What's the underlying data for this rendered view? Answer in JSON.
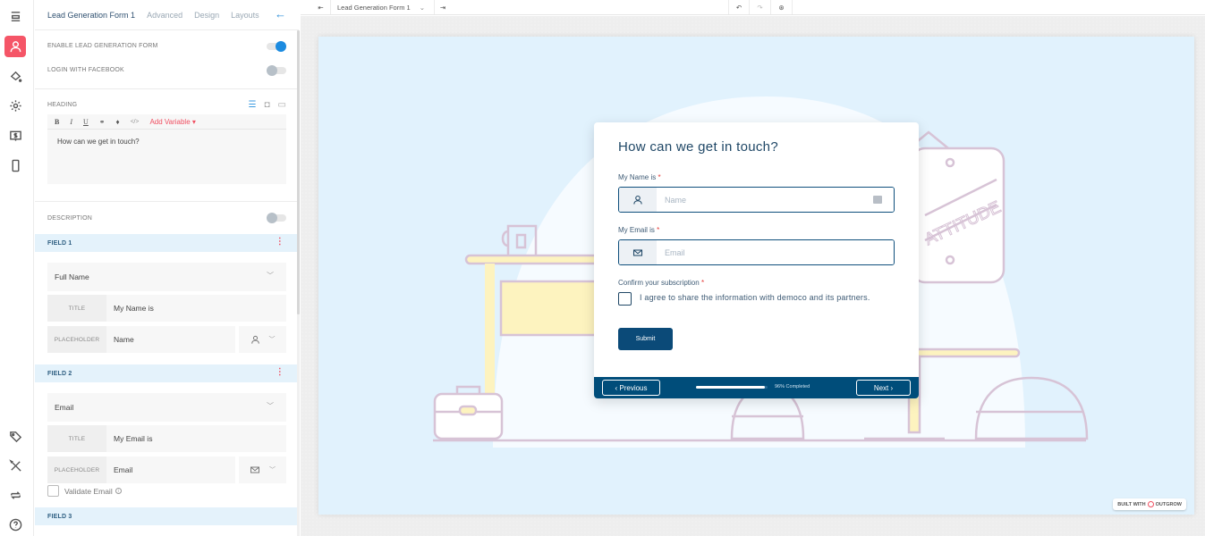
{
  "rail": {
    "items": [
      {
        "icon": "menu-icon",
        "active": false
      },
      {
        "icon": "user-icon",
        "active": true
      },
      {
        "icon": "paint-bucket-icon",
        "active": false
      },
      {
        "icon": "gear-icon",
        "active": false
      },
      {
        "icon": "pricing-icon",
        "active": false
      },
      {
        "icon": "mobile-icon",
        "active": false
      },
      {
        "icon": "tag-icon",
        "active": false
      },
      {
        "icon": "tools-icon",
        "active": false
      },
      {
        "icon": "sync-icon",
        "active": false
      },
      {
        "icon": "help-icon",
        "active": false
      }
    ]
  },
  "panel": {
    "tabs": [
      "Lead Generation Form 1",
      "Advanced",
      "Design",
      "Layouts"
    ],
    "active_tab": "Lead Generation Form 1",
    "back_icon": "←",
    "toggles": [
      {
        "label": "ENABLE LEAD GENERATION FORM",
        "on": true
      },
      {
        "label": "LOGIN WITH FACEBOOK",
        "on": false
      }
    ],
    "heading": {
      "label": "HEADING",
      "tools": [
        "☰",
        "◘",
        "▭"
      ],
      "toolbar": [
        "B",
        "I",
        "U",
        "⚭",
        "♦",
        "</>"
      ],
      "add_variable": "Add Variable ▾",
      "text": "How can we get in touch?"
    },
    "description": {
      "label": "DESCRIPTION",
      "on": false
    },
    "fields": [
      {
        "header": "FIELD 1",
        "type": "Full Name",
        "title_label": "TITLE",
        "title": "My Name is",
        "placeholder_label": "PLACEHOLDER",
        "placeholder": "Name",
        "icon": "user-icon"
      },
      {
        "header": "FIELD 2",
        "type": "Email",
        "title_label": "TITLE",
        "title": "My Email is",
        "placeholder_label": "PLACEHOLDER",
        "placeholder": "Email",
        "icon": "mail-icon",
        "validate_label": "Validate Email",
        "validate": false
      },
      {
        "header": "FIELD 3"
      }
    ]
  },
  "topbar": {
    "form_select": "Lead Generation Form 1",
    "chevron": "⌄"
  },
  "form": {
    "title": "How can we get in touch?",
    "name_label": "My Name is",
    "name_placeholder": "Name",
    "email_label": "My Email is",
    "email_placeholder": "Email",
    "required_mark": "*",
    "consent_label": "Confirm your subscription",
    "consent_text": "I agree to share the information with democo and its partners.",
    "submit": "Submit",
    "previous": "‹  Previous",
    "next": "Next  ›",
    "progress_percent": 96,
    "progress_text": "96% Completed",
    "colors": {
      "primary": "#0b4a78",
      "footer": "#004d7a",
      "required": "#e53935"
    }
  },
  "badge": {
    "left": "BUILT WITH",
    "right": "OUTGROW"
  }
}
